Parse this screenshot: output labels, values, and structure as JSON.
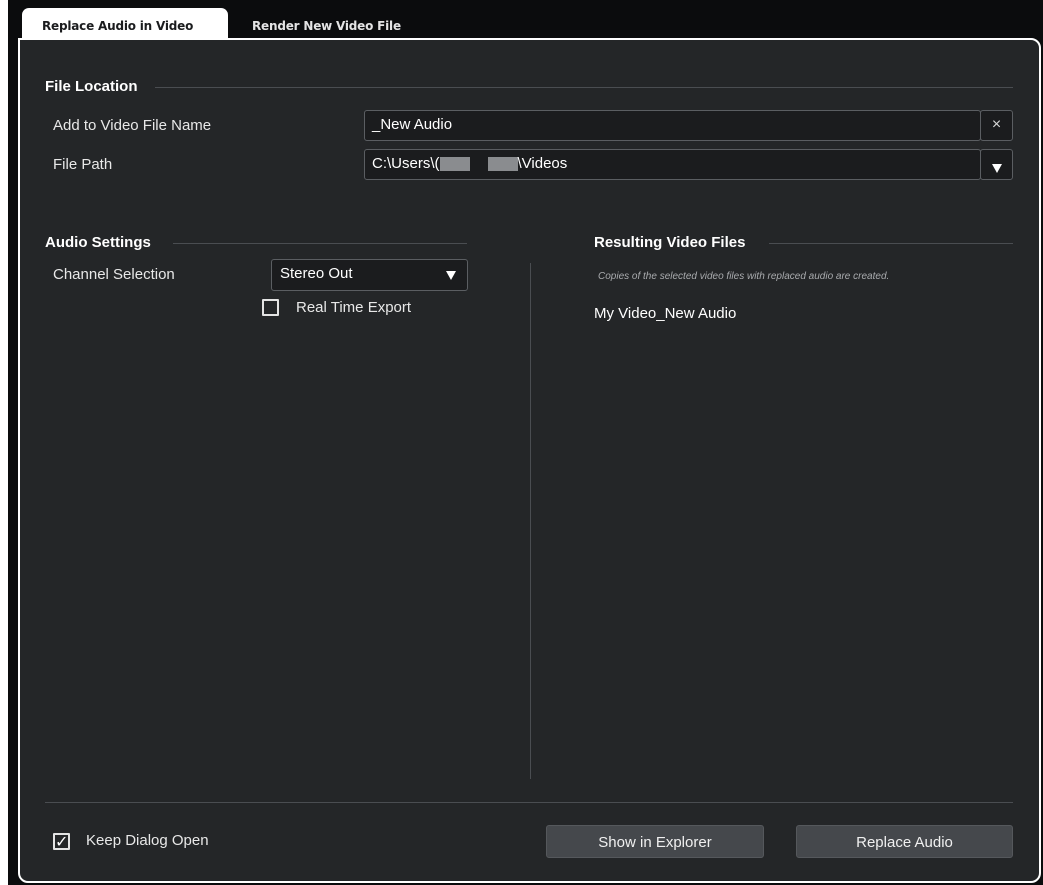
{
  "tabs": {
    "active_label": "Replace Audio in Video",
    "inactive_label": "Render New Video File"
  },
  "file_location": {
    "header": "File Location",
    "name_label": "Add to Video File Name",
    "name_value": "_New Audio",
    "clear_symbol": "×",
    "path_label": "File Path",
    "path_prefix": "C:\\Users\\(",
    "path_suffix": "\\Videos"
  },
  "audio_settings": {
    "header": "Audio Settings",
    "channel_label": "Channel Selection",
    "channel_value": "Stereo Out",
    "realtime_label": "Real Time Export",
    "realtime_checked": false
  },
  "resulting": {
    "header": "Resulting Video Files",
    "note": "Copies of the selected video files with replaced audio are created.",
    "files": [
      "My Video_New Audio"
    ]
  },
  "footer": {
    "keep_open_label": "Keep Dialog Open",
    "keep_open_checked": true,
    "check_mark": "✓",
    "show_button": "Show in Explorer",
    "replace_button": "Replace Audio"
  },
  "colors": {
    "background": "#242628",
    "field_background": "#1b1c1e",
    "button_background": "#45484c",
    "frame": "#0b0c0d"
  },
  "icons": [
    "close-icon",
    "chevron-down-icon",
    "checkbox-icon",
    "checkmark-icon"
  ]
}
